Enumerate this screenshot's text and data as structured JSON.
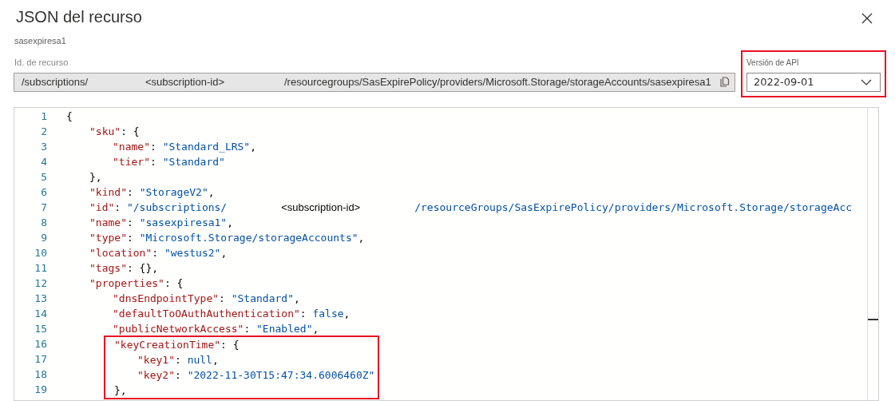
{
  "dialog": {
    "title": "JSON del recurso",
    "subtitle": "sasexpiresa1"
  },
  "resource_id": {
    "label": "Id. de recurso",
    "parts": [
      "/subscriptions/",
      "<subscription-id>",
      "/resourcegroups/SasExpirePolicy/providers/Microsoft.Storage/storageAccounts/sasexpiresa1"
    ]
  },
  "api_version": {
    "label": "Versión de API",
    "value": "2022-09-01",
    "highlighted": true
  },
  "code": {
    "lines": [
      {
        "number": "1",
        "highlighted": false,
        "tokens": [
          {
            "kind": "punct",
            "text": "{"
          }
        ],
        "children": [
          {
            "number": "2",
            "highlighted": false,
            "tokens": [
              {
                "kind": "key",
                "text": "\"sku\""
              },
              {
                "kind": "punct",
                "text": ": {"
              }
            ],
            "children": [
              {
                "number": "3",
                "highlighted": false,
                "tokens": [
                  {
                    "kind": "key",
                    "text": "\"name\""
                  },
                  {
                    "kind": "punct",
                    "text": ": "
                  },
                  {
                    "kind": "string",
                    "text": "\"Standard_LRS\""
                  },
                  {
                    "kind": "punct",
                    "text": ","
                  }
                ]
              },
              {
                "number": "4",
                "highlighted": false,
                "tokens": [
                  {
                    "kind": "key",
                    "text": "\"tier\""
                  },
                  {
                    "kind": "punct",
                    "text": ": "
                  },
                  {
                    "kind": "string",
                    "text": "\"Standard\""
                  }
                ]
              }
            ]
          },
          {
            "number": "5",
            "highlighted": false,
            "tokens": [
              {
                "kind": "punct",
                "text": "},"
              }
            ]
          },
          {
            "number": "6",
            "highlighted": false,
            "tokens": [
              {
                "kind": "key",
                "text": "\"kind\""
              },
              {
                "kind": "punct",
                "text": ": "
              },
              {
                "kind": "string",
                "text": "\"StorageV2\""
              },
              {
                "kind": "punct",
                "text": ","
              }
            ]
          },
          {
            "number": "7",
            "highlighted": false,
            "tokens": [
              {
                "kind": "key",
                "text": "\"id\""
              },
              {
                "kind": "punct",
                "text": ": "
              },
              {
                "kind": "string",
                "text": "\"/subscriptions/"
              },
              {
                "kind": "plain",
                "text": "<subscription-id>"
              },
              {
                "kind": "string",
                "text": "/resourceGroups/SasExpirePolicy/providers/Microsoft.Storage/storageAcc"
              }
            ]
          },
          {
            "number": "8",
            "highlighted": false,
            "tokens": [
              {
                "kind": "key",
                "text": "\"name\""
              },
              {
                "kind": "punct",
                "text": ": "
              },
              {
                "kind": "string",
                "text": "\"sasexpiresa1\""
              },
              {
                "kind": "punct",
                "text": ","
              }
            ]
          },
          {
            "number": "9",
            "highlighted": false,
            "tokens": [
              {
                "kind": "key",
                "text": "\"type\""
              },
              {
                "kind": "punct",
                "text": ": "
              },
              {
                "kind": "string",
                "text": "\"Microsoft.Storage/storageAccounts\""
              },
              {
                "kind": "punct",
                "text": ","
              }
            ]
          },
          {
            "number": "10",
            "highlighted": false,
            "tokens": [
              {
                "kind": "key",
                "text": "\"location\""
              },
              {
                "kind": "punct",
                "text": ": "
              },
              {
                "kind": "string",
                "text": "\"westus2\""
              },
              {
                "kind": "punct",
                "text": ","
              }
            ]
          },
          {
            "number": "11",
            "highlighted": false,
            "tokens": [
              {
                "kind": "key",
                "text": "\"tags\""
              },
              {
                "kind": "punct",
                "text": ": {},"
              }
            ]
          },
          {
            "number": "12",
            "highlighted": false,
            "tokens": [
              {
                "kind": "key",
                "text": "\"properties\""
              },
              {
                "kind": "punct",
                "text": ": {"
              }
            ],
            "children": [
              {
                "number": "13",
                "highlighted": false,
                "tokens": [
                  {
                    "kind": "key",
                    "text": "\"dnsEndpointType\""
                  },
                  {
                    "kind": "punct",
                    "text": ": "
                  },
                  {
                    "kind": "string",
                    "text": "\"Standard\""
                  },
                  {
                    "kind": "punct",
                    "text": ","
                  }
                ]
              },
              {
                "number": "14",
                "highlighted": false,
                "tokens": [
                  {
                    "kind": "key",
                    "text": "\"defaultToOAuthAuthentication\""
                  },
                  {
                    "kind": "punct",
                    "text": ": "
                  },
                  {
                    "kind": "literal",
                    "text": "false"
                  },
                  {
                    "kind": "punct",
                    "text": ","
                  }
                ]
              },
              {
                "number": "15",
                "highlighted": false,
                "tokens": [
                  {
                    "kind": "key",
                    "text": "\"publicNetworkAccess\""
                  },
                  {
                    "kind": "punct",
                    "text": ": "
                  },
                  {
                    "kind": "string",
                    "text": "\"Enabled\""
                  },
                  {
                    "kind": "punct",
                    "text": ","
                  }
                ]
              },
              {
                "number": "16",
                "highlighted": true,
                "tokens": [
                  {
                    "kind": "key",
                    "text": "\"keyCreationTime\""
                  },
                  {
                    "kind": "punct",
                    "text": ": {"
                  }
                ],
                "children": [
                  {
                    "number": "17",
                    "highlighted": true,
                    "tokens": [
                      {
                        "kind": "key",
                        "text": "\"key1\""
                      },
                      {
                        "kind": "punct",
                        "text": ": "
                      },
                      {
                        "kind": "literal",
                        "text": "null"
                      },
                      {
                        "kind": "punct",
                        "text": ","
                      }
                    ]
                  },
                  {
                    "number": "18",
                    "highlighted": true,
                    "tokens": [
                      {
                        "kind": "key",
                        "text": "\"key2\""
                      },
                      {
                        "kind": "punct",
                        "text": ": "
                      },
                      {
                        "kind": "string",
                        "text": "\"2022-11-30T15:47:34.6006460Z\""
                      }
                    ]
                  }
                ]
              },
              {
                "number": "19",
                "highlighted": true,
                "tokens": [
                  {
                    "kind": "punct",
                    "text": "},"
                  }
                ]
              }
            ]
          }
        ]
      }
    ]
  }
}
